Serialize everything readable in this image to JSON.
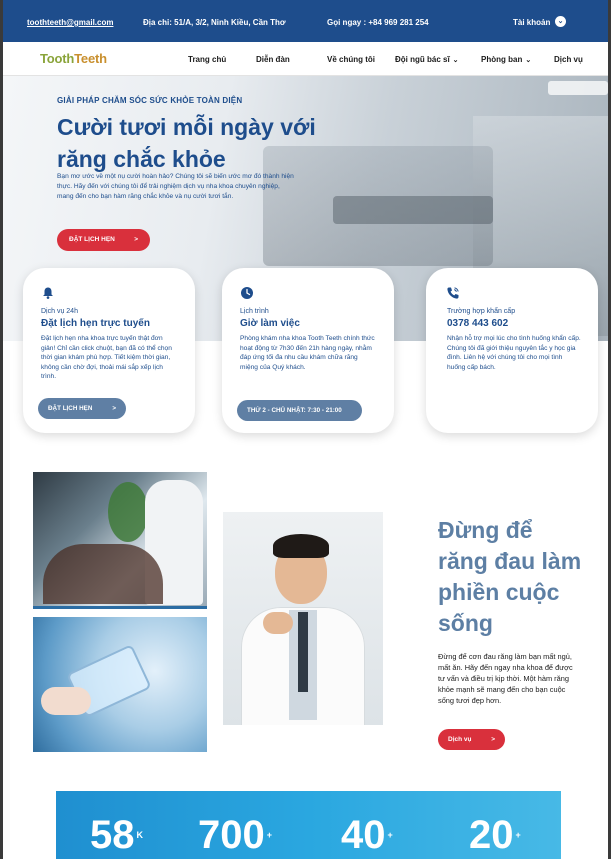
{
  "topbar": {
    "email": "toothteeth@gmail.com",
    "address": "Địa chỉ: 51/A, 3/2, Ninh Kiều, Cần Thơ",
    "phone": "Gọi ngay : +84 969 281 254",
    "account": "Tài khoản"
  },
  "nav": {
    "logo_part1": "Tooth",
    "logo_part2": "Teeth",
    "items": [
      {
        "label": "Trang chủ"
      },
      {
        "label": "Diễn đàn"
      },
      {
        "label": "Về chúng tôi"
      },
      {
        "label": "Đội ngũ bác sĩ"
      },
      {
        "label": "Phòng ban"
      },
      {
        "label": "Dịch vụ"
      }
    ]
  },
  "hero": {
    "kicker": "GIẢI PHÁP CHĂM SÓC SỨC KHỎE TOÀN DIỆN",
    "title": "Cười tươi mỗi ngày với răng chắc khỏe",
    "description": "Bạn mơ ước về một nụ cười hoàn hảo? Chúng tôi sẽ biến ước mơ đó thành hiện thực. Hãy đến với chúng tôi để trải nghiệm dịch vụ nha khoa chuyên nghiệp, mang đến cho bạn hàm răng chắc khỏe và nụ cười tươi tắn.",
    "cta": "ĐẶT LỊCH HẸN",
    "cta_arrow": ">"
  },
  "cards": [
    {
      "icon": "bell-icon",
      "sub": "Dịch vụ 24h",
      "head": "Đặt lịch hẹn trực tuyến",
      "body": "Đặt lịch hẹn nha khoa trực tuyến thật đơn giản! Chỉ cần click chuột, bạn đã có thể chọn thời gian khám phù hợp. Tiết kiệm thời gian, không cần chờ đợi, thoải mái sắp xếp lịch trình.",
      "button": "ĐẶT LỊCH HẸN",
      "button_arrow": ">"
    },
    {
      "icon": "clock-icon",
      "sub": "Lịch trình",
      "head": "Giờ làm việc",
      "body": "Phòng khám nha khoa Tooth Teeth chính thức hoạt động từ 7h30 đến 21h hàng ngày, nhằm đáp ứng tối đa nhu cầu khám chữa răng miệng của Quý khách.",
      "button": "THỨ 2 - CHỦ NHẬT: 7:30 - 21:00"
    },
    {
      "icon": "phone-icon",
      "sub": "Trường hợp khẩn cấp",
      "head": "0378 443 602",
      "body": "Nhận hỗ trợ mọi lúc cho tình huống khẩn cấp. Chúng tôi đã giới thiệu nguyên tắc y học gia đình. Liên hệ với chúng tôi cho mọi tình huống cấp bách."
    }
  ],
  "middle": {
    "title": "Đừng để răng đau làm phiền cuộc sống",
    "description": "Đừng để cơn đau răng làm bạn mất ngủ, mất ăn. Hãy đến ngay nha khoa để được tư vấn và điều trị kịp thời. Một hàm răng khỏe mạnh sẽ mang đến cho bạn cuộc sống tươi đẹp hơn.",
    "button": "Dịch vụ",
    "button_arrow": ">"
  },
  "stats": [
    {
      "value": "58",
      "suffix": "K"
    },
    {
      "value": "700",
      "suffix": "+"
    },
    {
      "value": "40",
      "suffix": "+"
    },
    {
      "value": "20",
      "suffix": "+"
    }
  ],
  "colors": {
    "primary": "#1e4d8c",
    "accent": "#d9303c",
    "muted_blue": "#5d7fa4"
  }
}
